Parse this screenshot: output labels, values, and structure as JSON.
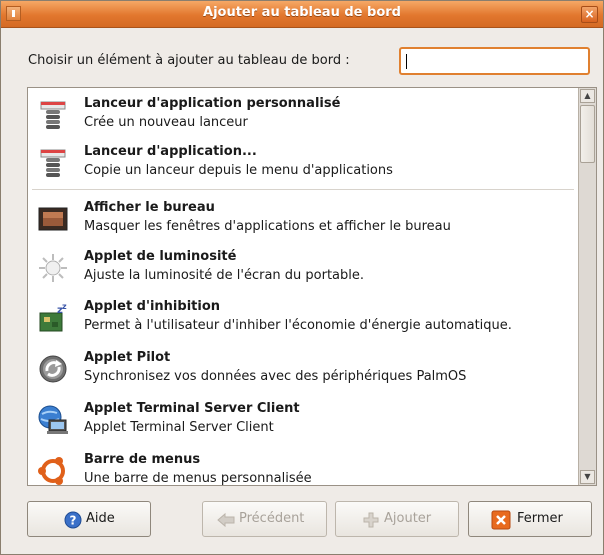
{
  "window": {
    "title": "Ajouter au tableau de bord",
    "close_glyph": "×"
  },
  "prompt": {
    "label": "Choisir un élément à ajouter au tableau de bord :",
    "value": ""
  },
  "list": {
    "items": [
      {
        "name": "Lanceur d'application personnalisé",
        "description": "Crée un nouveau lanceur",
        "icon": "launcher-icon"
      },
      {
        "name": "Lanceur d'application...",
        "description": "Copie un lanceur depuis le menu d'applications",
        "icon": "launcher-icon"
      },
      {
        "name": "Afficher le bureau",
        "description": "Masquer les fenêtres d'applications et afficher le bureau",
        "icon": "desktop-icon"
      },
      {
        "name": "Applet de luminosité",
        "description": "Ajuste la luminosité de l'écran du portable.",
        "icon": "brightness-icon"
      },
      {
        "name": "Applet d'inhibition",
        "description": "Permet à l'utilisateur d'inhiber l'économie d'énergie automatique.",
        "icon": "inhibit-icon"
      },
      {
        "name": "Applet Pilot",
        "description": "Synchronisez vos données avec des périphériques PalmOS",
        "icon": "pilot-icon"
      },
      {
        "name": "Applet Terminal Server Client",
        "description": "Applet Terminal Server Client",
        "icon": "terminal-server-icon"
      },
      {
        "name": "Barre de menus",
        "description": "Une barre de menus personnalisée",
        "icon": "ubuntu-menu-icon"
      }
    ]
  },
  "buttons": {
    "help": "Aide",
    "previous": "Précédent",
    "add": "Ajouter",
    "close": "Fermer"
  },
  "colors": {
    "titlebar": "#e2772e",
    "focus": "#e08030",
    "close_icon": "#e86a1e"
  }
}
